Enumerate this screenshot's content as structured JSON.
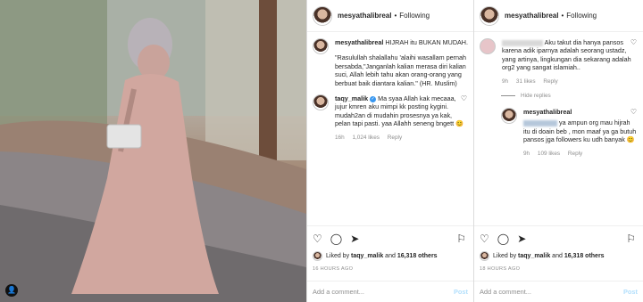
{
  "colors": {
    "link": "#3897f0",
    "muted": "#8e8e8e",
    "post_disabled": "#b2dffc",
    "text": "#262626"
  },
  "photo": {
    "tag_icon": "user-tag-icon"
  },
  "left_panel": {
    "header": {
      "username": "mesyathalibreal",
      "following": "Following"
    },
    "caption": {
      "username": "mesyathalibreal",
      "text": "HIJRAH itu BUKAN MUDAH.",
      "quote": "\"Rasulullah shalallahu 'alaihi wasallam pernah bersabda,\"Janganlah kalian merasa diri kalian suci, Allah lebih tahu akan orang-orang yang berbuat baik diantara kalian.\" (HR. Muslim)"
    },
    "comment": {
      "username": "taqy_malik",
      "text": "Ma syaa Allah kak mecaaa, jujur kmren aku mimpi kk posting kygini. mudah2an di mudahin prosesnya ya kak, pelan tapi pasti. yaa Allahh seneng bngett 😊",
      "time": "16h",
      "likes": "1,024 likes",
      "reply": "Reply"
    },
    "liked_by": {
      "prefix": "Liked by",
      "user": "taqy_malik",
      "joiner": "and",
      "others": "16,318 others"
    },
    "ago": "16 HOURS AGO",
    "add_comment_placeholder": "Add a comment...",
    "post": "Post"
  },
  "right_panel": {
    "header": {
      "username": "mesyathalibreal",
      "following": "Following"
    },
    "comment": {
      "text": "Aku takut dia hanya pansos karena adik iparnya adalah seorang ustadz, yang artinya, lingkungan dia sekarang adalah org2 yang sangat islamiah..",
      "time": "9h",
      "likes": "31 likes",
      "reply": "Reply"
    },
    "hide_replies": "Hide replies",
    "reply_comment": {
      "username": "mesyathalibreal",
      "text": "ya ampun org mau hijrah itu di doain beb , mon maaf ya ga butuh pansos jga followers ku udh banyak 😊",
      "time": "9h",
      "likes": "109 likes",
      "reply": "Reply"
    },
    "liked_by": {
      "prefix": "Liked by",
      "user": "taqy_malik",
      "joiner": "and",
      "others": "16,318 others"
    },
    "ago": "18 HOURS AGO",
    "add_comment_placeholder": "Add a comment...",
    "post": "Post"
  },
  "icons": {
    "heart": "♡",
    "comment": "◯",
    "share": "➤",
    "save": "⚐",
    "dots": "···",
    "check": "✓",
    "tag": "👤"
  }
}
